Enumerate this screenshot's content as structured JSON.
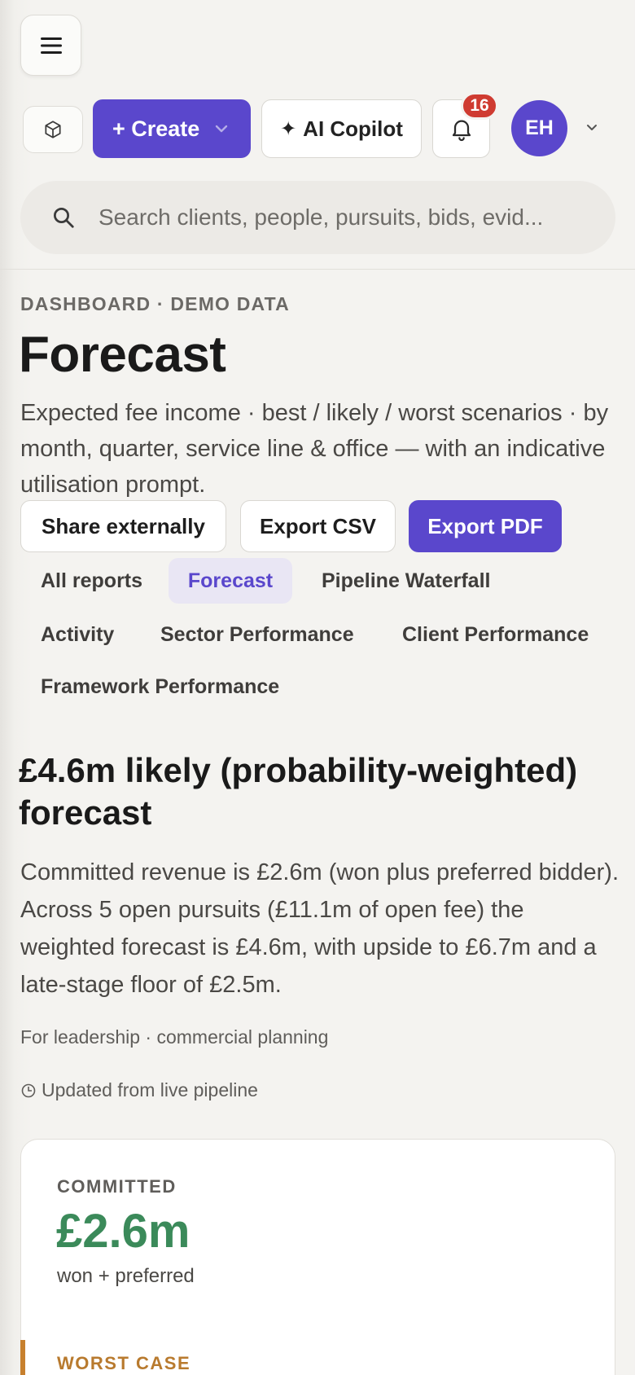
{
  "header": {
    "create_label": "+ Create",
    "copilot_label": "AI Copilot",
    "notification_count": "16",
    "avatar_initials": "EH"
  },
  "search": {
    "placeholder": "Search clients, people, pursuits, bids, evid..."
  },
  "page": {
    "eyebrow": "DASHBOARD · DEMO DATA",
    "title": "Forecast",
    "subtitle": "Expected fee income · best / likely / worst scenarios · by month, quarter, service line & office — with an indicative utilisation prompt."
  },
  "actions": {
    "share": "Share externally",
    "csv": "Export CSV",
    "pdf": "Export PDF"
  },
  "tabs": [
    {
      "label": "All reports"
    },
    {
      "label": "Forecast",
      "active": true
    },
    {
      "label": "Pipeline Waterfall"
    },
    {
      "label": "Activity"
    },
    {
      "label": "Sector Performance"
    },
    {
      "label": "Client Performance"
    },
    {
      "label": "Framework Performance"
    }
  ],
  "summary": {
    "headline": "£4.6m likely (probability-weighted) forecast",
    "body": "Committed revenue is £2.6m (won plus preferred bidder). Across 5 open pursuits (£11.1m of open fee) the weighted forecast is £4.6m, with upside to £6.7m and a late-stage floor of £2.5m.",
    "audience": "For leadership · commercial planning",
    "updated": "Updated from live pipeline"
  },
  "cards": {
    "committed": {
      "label": "COMMITTED",
      "value": "£2.6m",
      "sub": "won + preferred",
      "color": "#3b8a5a"
    },
    "worst": {
      "label": "WORST CASE",
      "color": "#c7802e"
    }
  },
  "colors": {
    "accent": "#5a47cc",
    "badge": "#cf3b31"
  }
}
